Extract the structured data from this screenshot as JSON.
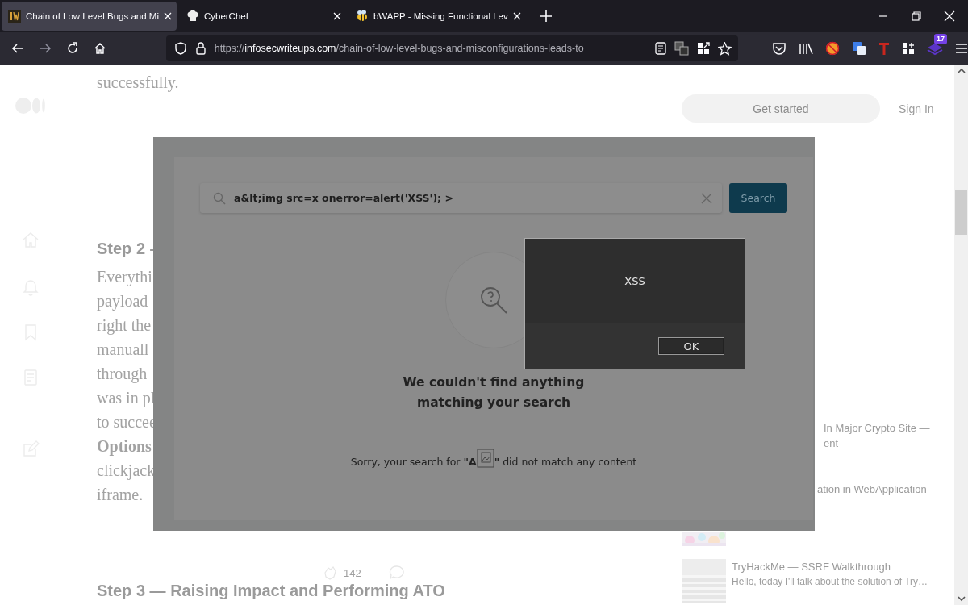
{
  "browser": {
    "tabs": [
      {
        "title": "Chain of Low Level Bugs and Mi",
        "selected": true
      },
      {
        "title": "CyberChef",
        "selected": false
      },
      {
        "title": "bWAPP - Missing Functional Lev",
        "selected": false
      }
    ],
    "nav_buttons": [
      {
        "kind": "back",
        "disabled": false
      },
      {
        "kind": "forward",
        "disabled": true
      },
      {
        "kind": "reload",
        "disabled": false
      },
      {
        "kind": "home",
        "disabled": false
      }
    ],
    "url": {
      "scheme": "https://",
      "domain": "infosecwriteups.com",
      "path": "/chain-of-low-level-bugs-and-misconfigurations-leads-to"
    },
    "extension_badge": "17"
  },
  "article": {
    "intro_line": "successfully.",
    "heading": "Step 2 –",
    "paragraph_lines": [
      {
        "text": "Everythi",
        "bold": false
      },
      {
        "text": "payload",
        "bold": false
      },
      {
        "text": "right the",
        "bold": false
      },
      {
        "text": "manuall",
        "bold": false
      },
      {
        "text": "through",
        "bold": false
      },
      {
        "text": "was in pl",
        "bold": false
      },
      {
        "text": "to succee",
        "bold": false
      },
      {
        "text": "Options",
        "bold": true
      },
      {
        "text": "clickjack",
        "bold": false
      },
      {
        "text": "iframe.",
        "bold": false
      }
    ],
    "claps": "142",
    "next_heading": "Step 3 — Raising Impact and Performing ATO"
  },
  "sidebar": {
    "get_started": "Get started",
    "sign_in": "Sign In",
    "stories": [
      {
        "title_lines": [
          "In Major Crypto Site —",
          "ent"
        ]
      },
      {
        "title_lines": [
          "ation in WebApplication"
        ]
      },
      {
        "title_lines": [
          "TryHackMe — SSRF Walkthrough"
        ],
        "excerpt": "Hello, today I'll talk about the solution of Try…"
      }
    ]
  },
  "screenshot": {
    "search": {
      "value": "a&lt;img src=x onerror=alert('XSS'); >",
      "button": "Search"
    },
    "empty_title_lines": [
      "We couldn't find anything",
      "matching your search"
    ],
    "message_start": "Sorry, your search for **\"A**",
    "message_end": "**\"** did not match any content",
    "alert": {
      "message": "XSS",
      "button": "OK"
    }
  }
}
